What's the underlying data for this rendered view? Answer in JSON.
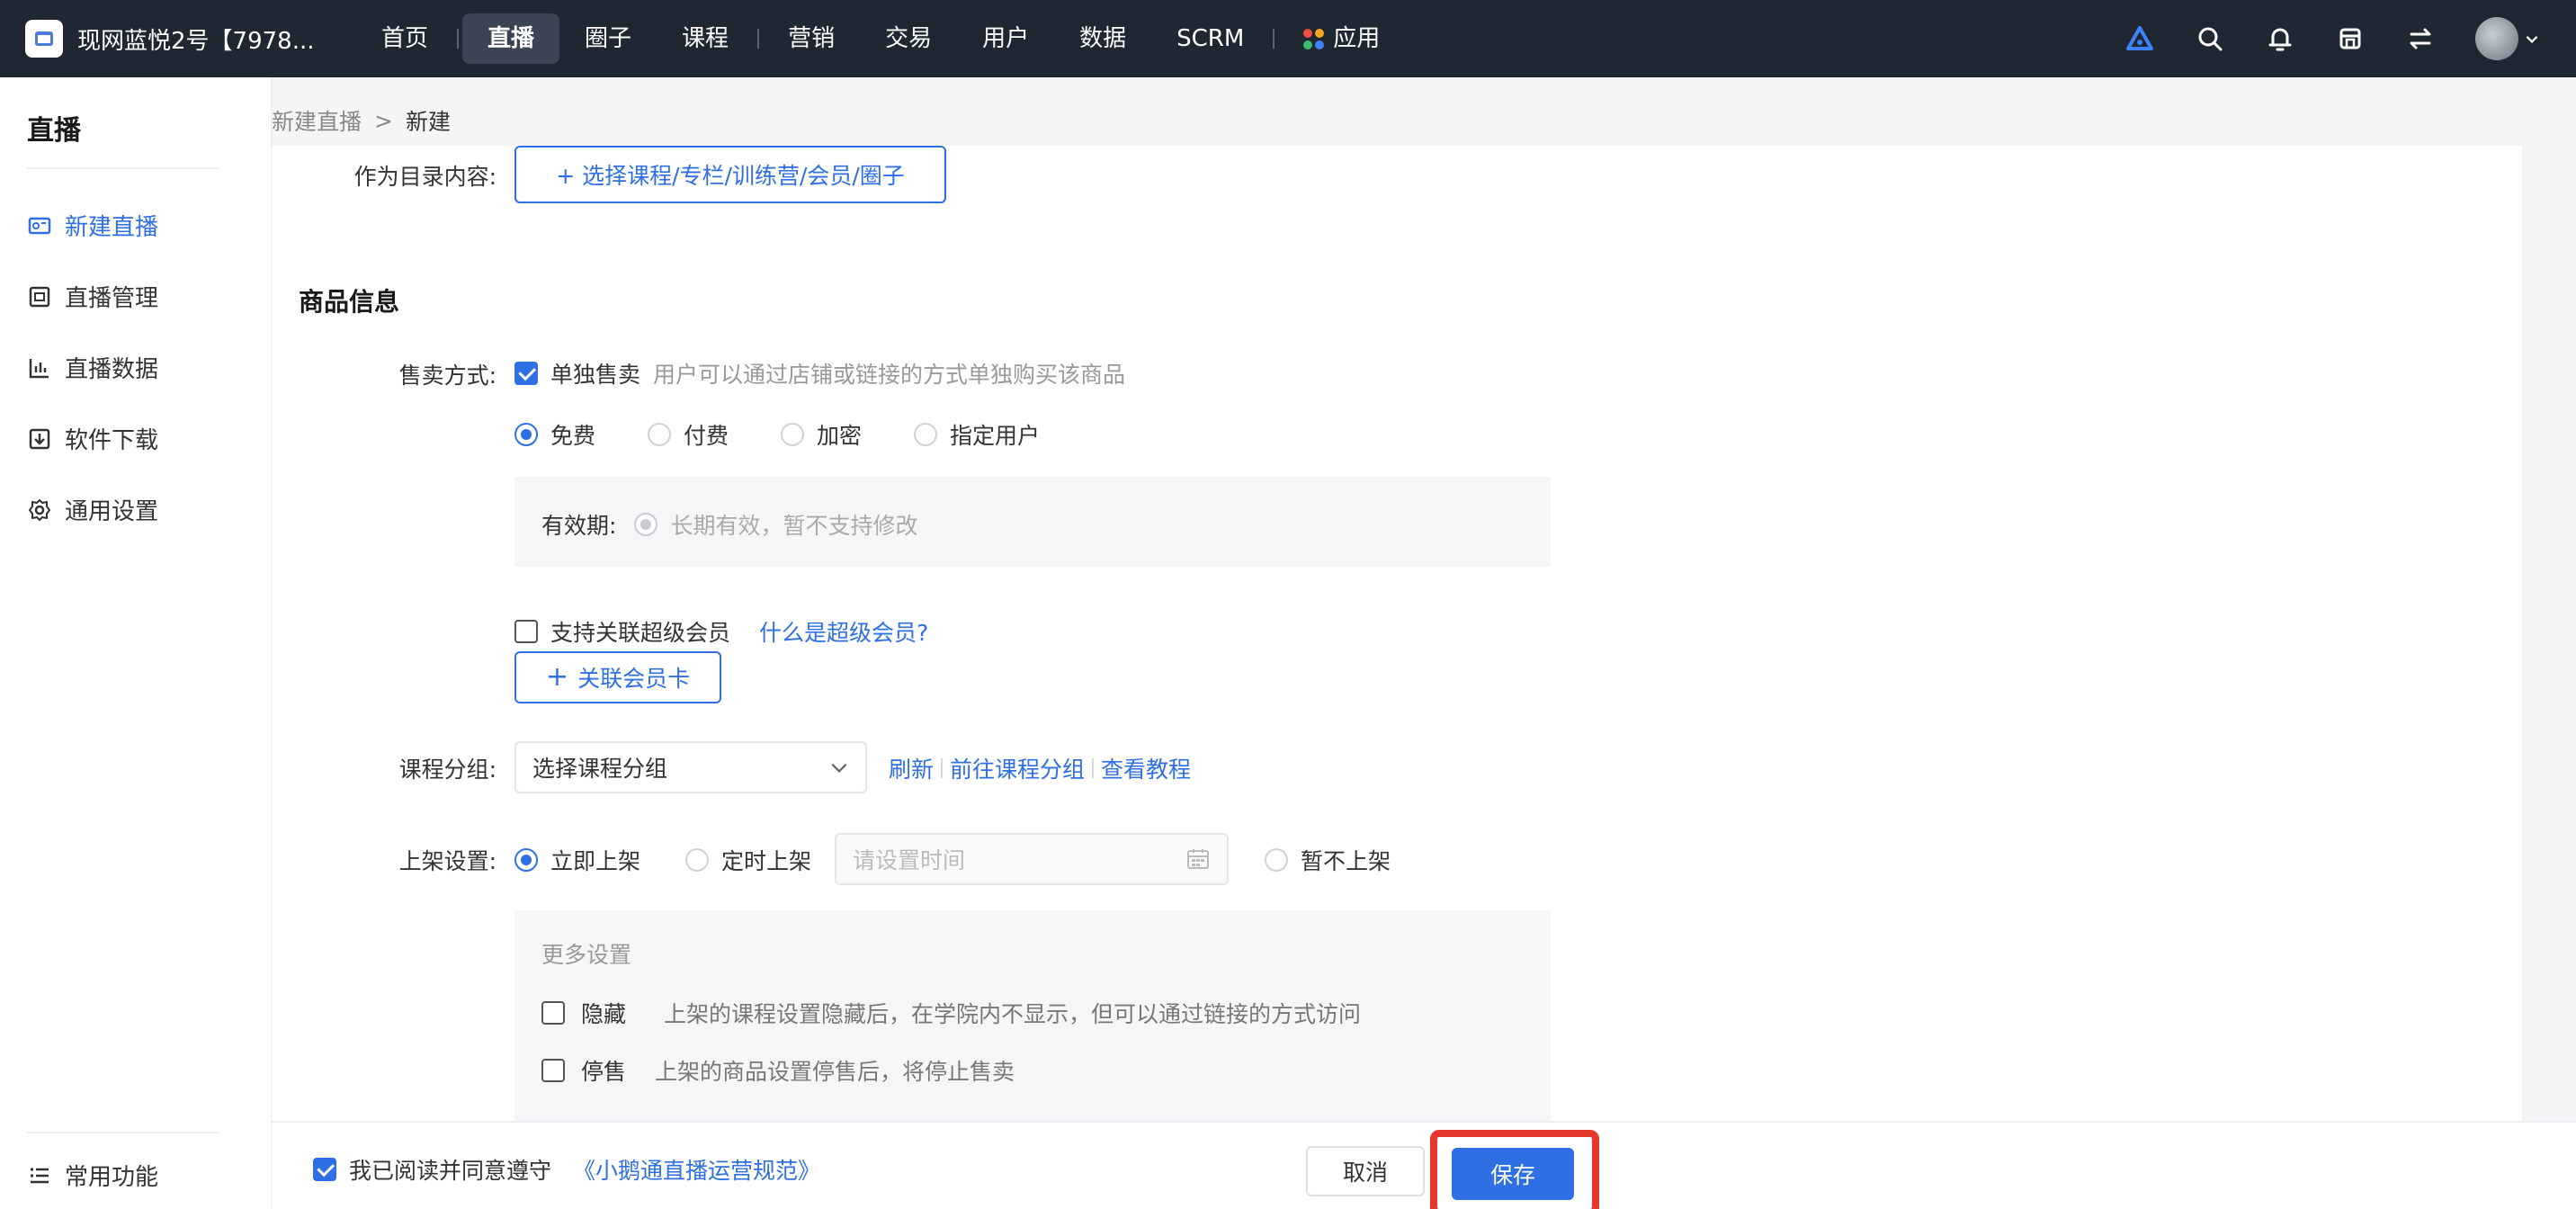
{
  "topbar": {
    "shop_name": "现网蓝悦2号【7978...",
    "nav": [
      "首页",
      "直播",
      "圈子",
      "课程",
      "营销",
      "交易",
      "用户",
      "数据",
      "SCRM",
      "应用"
    ],
    "active_nav": "直播"
  },
  "sidebar": {
    "title": "直播",
    "items": [
      "新建直播",
      "直播管理",
      "直播数据",
      "软件下载",
      "通用设置"
    ],
    "bottom_item": "常用功能"
  },
  "breadcrumb": {
    "parent": "新建直播",
    "separator": ">",
    "current": "新建"
  },
  "form": {
    "catalog_label": "作为目录内容:",
    "catalog_button": "+ 选择课程/专栏/训练营/会员/圈子",
    "section_title": "商品信息",
    "sale_label": "售卖方式:",
    "sale_single": "单独售卖",
    "sale_single_hint": "用户可以通过店铺或链接的方式单独购买该商品",
    "price_options": [
      "免费",
      "付费",
      "加密",
      "指定用户"
    ],
    "validity_label": "有效期:",
    "validity_value": "长期有效，暂不支持修改",
    "super_member_label": "支持关联超级会员",
    "super_member_link": "什么是超级会员?",
    "member_card_button": "关联会员卡",
    "group_label": "课程分组:",
    "group_placeholder": "选择课程分组",
    "group_links": [
      "刷新",
      "前往课程分组",
      "查看教程"
    ],
    "shelf_label": "上架设置:",
    "shelf_now": "立即上架",
    "shelf_timed": "定时上架",
    "shelf_time_placeholder": "请设置时间",
    "shelf_not": "暂不上架",
    "more_title": "更多设置",
    "hide_label": "隐藏",
    "hide_hint": "上架的课程设置隐藏后，在学院内不显示，但可以通过链接的方式访问",
    "stop_label": "停售",
    "stop_hint": "上架的商品设置停售后，将停止售卖"
  },
  "footer": {
    "agree_text": "我已阅读并同意遵守",
    "agree_link": "《小鹅通直播运营规范》",
    "cancel": "取消",
    "save": "保存"
  },
  "colors": {
    "accent": "#2f6fe4",
    "topbar": "#1f2733",
    "highlight": "#e6372b"
  },
  "icons": {
    "topbar": [
      "brand-logo-icon",
      "search-icon",
      "bell-icon",
      "store-icon",
      "switch-icon",
      "avatar"
    ],
    "sidebar": [
      "live-icon",
      "manage-icon",
      "chart-icon",
      "download-icon",
      "gear-icon",
      "list-icon"
    ]
  }
}
